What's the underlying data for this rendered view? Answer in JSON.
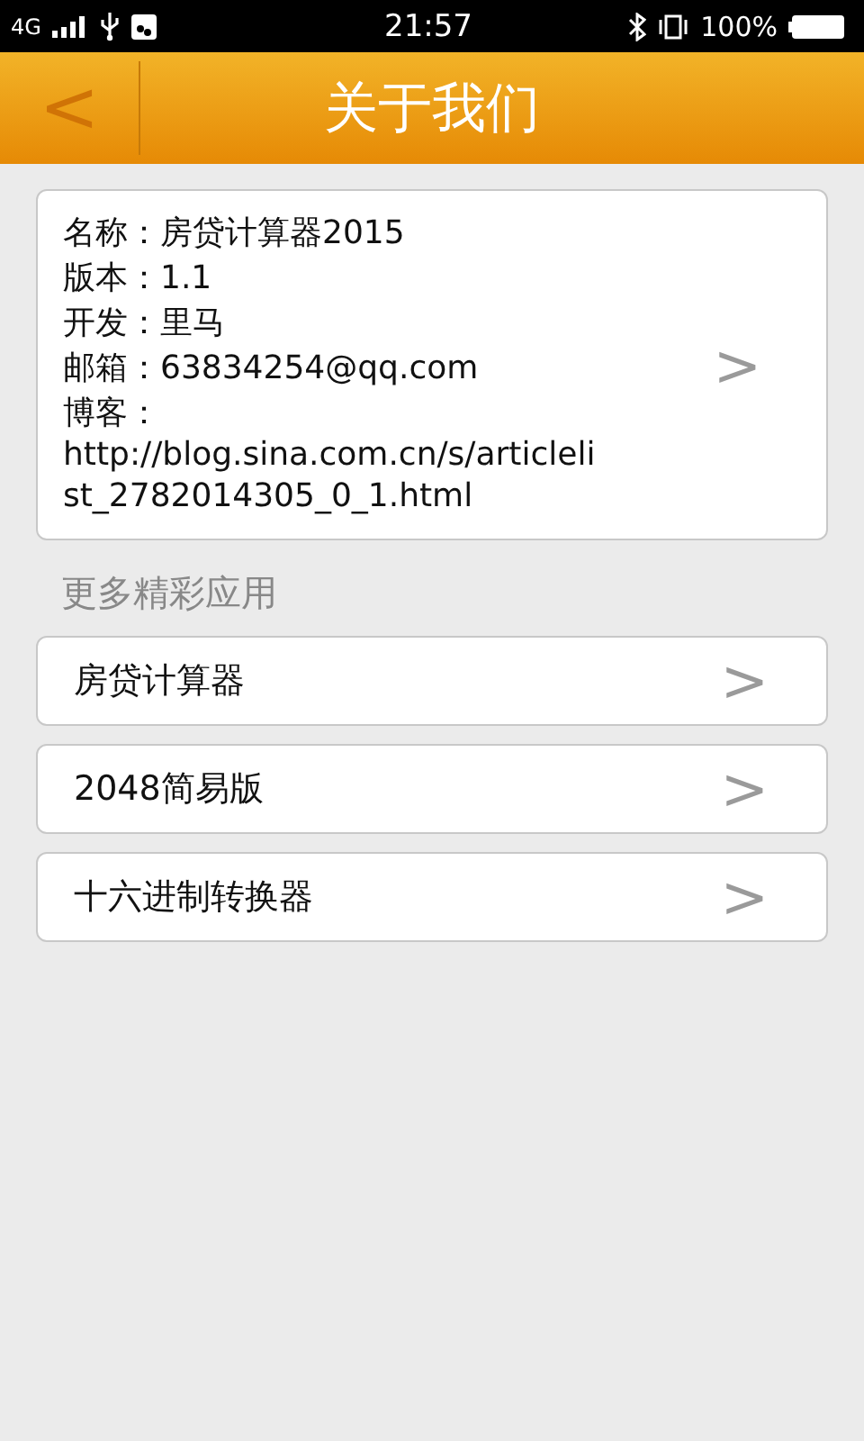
{
  "status_bar": {
    "network": "4G",
    "time": "21:57",
    "battery": "100%"
  },
  "header": {
    "back": "<",
    "title": "关于我们"
  },
  "info": {
    "lines": [
      "名称：房贷计算器2015",
      "版本：1.1",
      "开发：里马",
      "邮箱：63834254@qq.com",
      "博客：http://blog.sina.com.cn/s/articlelist_2782014305_0_1.html"
    ],
    "chevron": ">"
  },
  "section_title": "更多精彩应用",
  "apps": [
    {
      "label": "房贷计算器",
      "chevron": ">"
    },
    {
      "label": "2048简易版",
      "chevron": ">"
    },
    {
      "label": "十六进制转换器",
      "chevron": ">"
    }
  ]
}
